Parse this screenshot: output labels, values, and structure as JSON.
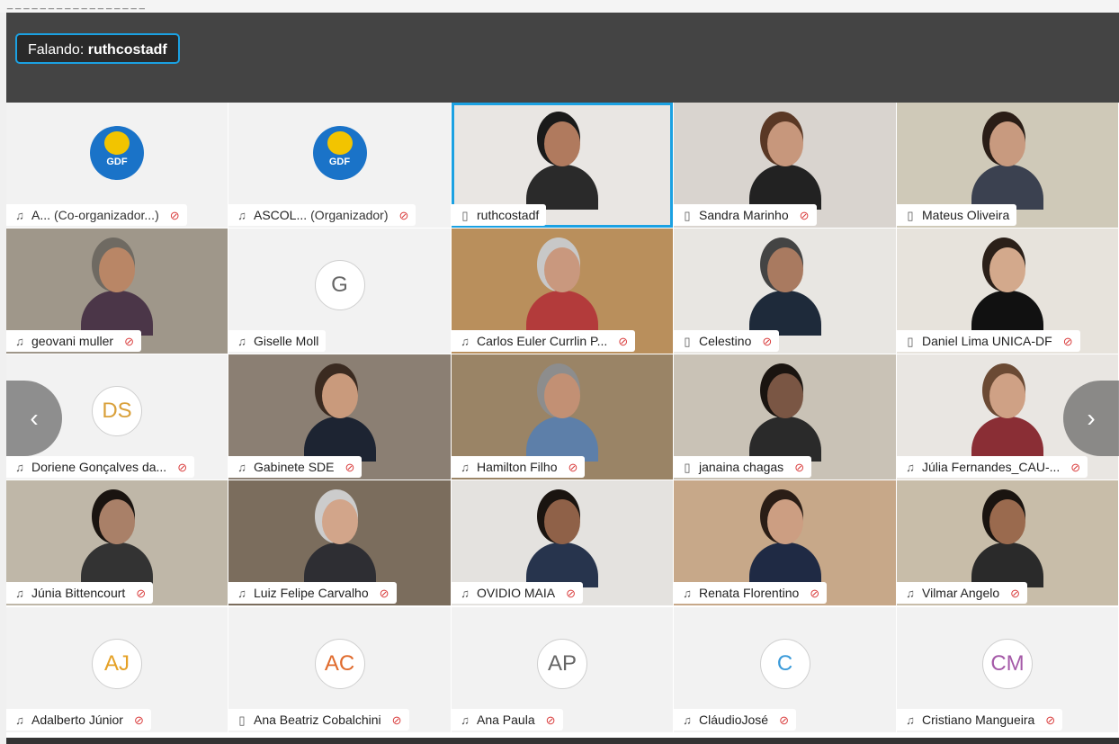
{
  "window_title": "_ _ _ _ _ _ _ _ _ _ _ _ _ _ _ _ _",
  "speaking": {
    "prefix": "Falando:",
    "name": "ruthcostadf"
  },
  "accent": "#1ba1e2",
  "mute_color": "#d93b3b",
  "participants": [
    {
      "name": "A...",
      "role": "(Co-organizador...)",
      "type": "logo",
      "logo_text": "GDF",
      "device": "headset-connected-icon",
      "muted": true
    },
    {
      "name": "ASCOL...",
      "role": "(Organizador)",
      "type": "logo",
      "logo_text": "GDF",
      "device": "headset-icon",
      "muted": true
    },
    {
      "name": "ruthcostadf",
      "role": "",
      "type": "video",
      "device": "phone-icon",
      "muted": false,
      "active": true,
      "skin": "#b07a5e",
      "hair": "#1a1a1a",
      "shirt": "#2a2a2a",
      "bg": "#e9e6e3"
    },
    {
      "name": "Sandra Marinho",
      "role": "",
      "type": "video",
      "device": "phone-icon",
      "muted": true,
      "skin": "#c7977c",
      "hair": "#5a3825",
      "shirt": "#222",
      "bg": "#d9d4cf"
    },
    {
      "name": "Mateus Oliveira",
      "role": "",
      "type": "video",
      "device": "phone-icon",
      "muted": false,
      "skin": "#c89a7f",
      "hair": "#2a1d16",
      "shirt": "#3b4150",
      "bg": "#cfc9b8"
    },
    {
      "name": "geovani muller",
      "role": "",
      "type": "video",
      "device": "headset-icon",
      "muted": true,
      "skin": "#b98666",
      "hair": "#6f6a62",
      "shirt": "#4b3648",
      "bg": "#9f978a"
    },
    {
      "name": "Giselle Moll",
      "role": "",
      "type": "initials",
      "initials": "G",
      "initials_color": "#666666",
      "device": "headset-icon",
      "muted": false
    },
    {
      "name": "Carlos Euler Currlin P...",
      "role": "",
      "type": "video",
      "device": "headset-icon",
      "muted": true,
      "skin": "#c9987e",
      "hair": "#c8c8c8",
      "shirt": "#b33b3b",
      "bg": "#b98f5c"
    },
    {
      "name": "Celestino",
      "role": "",
      "type": "video",
      "device": "phone-icon",
      "muted": true,
      "skin": "#a97a60",
      "hair": "#444",
      "shirt": "#1e2a3a",
      "bg": "#e8e6e2"
    },
    {
      "name": "Daniel Lima UNICA-DF",
      "role": "",
      "type": "video",
      "device": "phone-icon",
      "muted": true,
      "skin": "#d3a98c",
      "hair": "#2b2019",
      "shirt": "#111",
      "bg": "#e7e3dc"
    },
    {
      "name": "Doriene Gonçalves da...",
      "role": "",
      "type": "initials",
      "initials": "DS",
      "initials_color": "#d9a03a",
      "device": "headset-icon",
      "muted": true
    },
    {
      "name": "Gabinete SDE",
      "role": "",
      "type": "video",
      "device": "headset-icon",
      "muted": true,
      "skin": "#c99a7c",
      "hair": "#3a2a20",
      "shirt": "#1d2432",
      "bg": "#8b7f73"
    },
    {
      "name": "Hamilton Filho",
      "role": "",
      "type": "video",
      "device": "headset-icon",
      "muted": true,
      "skin": "#c29074",
      "hair": "#8d8d8d",
      "shirt": "#5d7fa9",
      "bg": "#9a8466"
    },
    {
      "name": "janaina chagas",
      "role": "",
      "type": "video",
      "device": "phone-icon",
      "muted": true,
      "skin": "#7a5644",
      "hair": "#1a1410",
      "shirt": "#2a2a2a",
      "bg": "#c9c2b6"
    },
    {
      "name": "Júlia Fernandes_CAU-...",
      "role": "",
      "type": "video",
      "device": "headset-icon",
      "muted": true,
      "skin": "#cfa185",
      "hair": "#6b4a34",
      "shirt": "#8a2e35",
      "bg": "#e9e6e2"
    },
    {
      "name": "Júnia Bittencourt",
      "role": "",
      "type": "video",
      "device": "headset-icon",
      "muted": true,
      "skin": "#a98068",
      "hair": "#1a1410",
      "shirt": "#333",
      "bg": "#bfb7a8"
    },
    {
      "name": "Luiz Felipe Carvalho",
      "role": "",
      "type": "video",
      "device": "headset-icon",
      "muted": true,
      "skin": "#d2a58a",
      "hair": "#ccc",
      "shirt": "#2e2e33",
      "bg": "#7b6d5d"
    },
    {
      "name": "OVIDIO MAIA",
      "role": "",
      "type": "video",
      "device": "headset-icon",
      "muted": true,
      "skin": "#8f6148",
      "hair": "#1a1410",
      "shirt": "#27344d",
      "bg": "#e4e2df"
    },
    {
      "name": "Renata Florentino",
      "role": "",
      "type": "video",
      "device": "headset-icon",
      "muted": true,
      "skin": "#cc9e82",
      "hair": "#2a1d16",
      "shirt": "#1f2a44",
      "bg": "#c7a889"
    },
    {
      "name": "Vilmar Angelo",
      "role": "",
      "type": "video",
      "device": "headset-icon",
      "muted": true,
      "skin": "#9a6a4e",
      "hair": "#1a1410",
      "shirt": "#2a2a2a",
      "bg": "#c8bda9"
    },
    {
      "name": "Adalberto Júnior",
      "role": "",
      "type": "initials",
      "initials": "AJ",
      "initials_color": "#e5a126",
      "device": "headset-icon",
      "muted": true
    },
    {
      "name": "Ana Beatriz Cobalchini",
      "role": "",
      "type": "initials",
      "initials": "AC",
      "initials_color": "#e06b2d",
      "device": "phone-icon",
      "muted": true
    },
    {
      "name": "Ana Paula",
      "role": "",
      "type": "initials",
      "initials": "AP",
      "initials_color": "#666666",
      "device": "headset-icon",
      "muted": true
    },
    {
      "name": "CláudioJosé",
      "role": "",
      "type": "initials",
      "initials": "C",
      "initials_color": "#3a9ad9",
      "device": "headset-icon",
      "muted": true
    },
    {
      "name": "Cristiano Mangueira",
      "role": "",
      "type": "initials",
      "initials": "CM",
      "initials_color": "#a55aa8",
      "device": "headset-icon",
      "muted": true
    }
  ],
  "nav": {
    "prev": "‹",
    "next": "›"
  }
}
